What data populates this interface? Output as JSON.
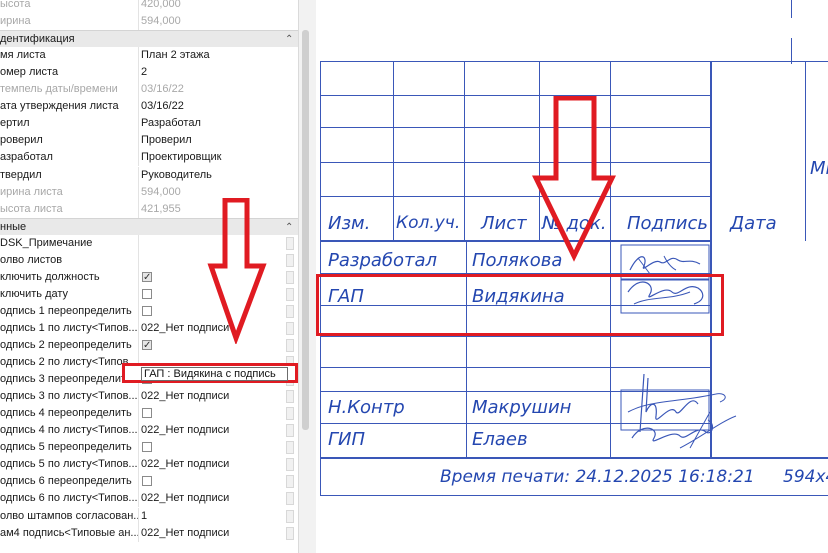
{
  "properties": {
    "rows": [
      {
        "name": "ысота",
        "value": "420,000",
        "dim": true
      },
      {
        "name": "ирина",
        "value": "594,000",
        "dim": true
      },
      {
        "name": "дентификация",
        "section": true
      },
      {
        "name": "мя листа",
        "value": "План 2  этажа"
      },
      {
        "name": "омер листа",
        "value": "2"
      },
      {
        "name": "темпель даты/времени",
        "value": "03/16/22",
        "dim": true
      },
      {
        "name": "ата утверждения листа",
        "value": "03/16/22"
      },
      {
        "name": "ертил",
        "value": "Разработал"
      },
      {
        "name": "роверил",
        "value": "Проверил"
      },
      {
        "name": "азработал",
        "value": "Проектировщик"
      },
      {
        "name": "твердил",
        "value": "Руководитель"
      },
      {
        "name": "ирина листа",
        "value": "594,000",
        "dim": true
      },
      {
        "name": "ысота листа",
        "value": "421,955",
        "dim": true
      },
      {
        "name": "нные",
        "section": true
      },
      {
        "name": "DSK_Примечание",
        "value": ""
      },
      {
        "name": "олво листов",
        "value": ""
      },
      {
        "name": "ключить должность",
        "checkbox": true,
        "checked": true
      },
      {
        "name": "ключить дату",
        "checkbox": true,
        "checked": false
      },
      {
        "name": "одпись 1 переопределить",
        "checkbox": true,
        "checked": false
      },
      {
        "name": "одпись 1 по листу<Типов...",
        "value": "022_Нет подписи"
      },
      {
        "name": "одпись 2 переопределить",
        "checkbox": true,
        "checked": true
      },
      {
        "name": "одпись 2 по листу<Типов...",
        "value": "ГАП : Видякина с подпись",
        "editing": true
      },
      {
        "name": "одпись 3 переопределить",
        "checkbox": true,
        "checked": false
      },
      {
        "name": "одпись 3 по листу<Типов...",
        "value": "022_Нет подписи"
      },
      {
        "name": "одпись 4 переопределить",
        "checkbox": true,
        "checked": false
      },
      {
        "name": "одпись 4 по листу<Типов...",
        "value": "022_Нет подписи"
      },
      {
        "name": "одпись 5 переопределить",
        "checkbox": true,
        "checked": false
      },
      {
        "name": "одпись 5 по листу<Типов...",
        "value": "022_Нет подписи"
      },
      {
        "name": "одпись 6 переопределить",
        "checkbox": true,
        "checked": false
      },
      {
        "name": "одпись 6 по листу<Типов...",
        "value": "022_Нет подписи"
      },
      {
        "name": "олво штампов согласован...",
        "value": "1"
      },
      {
        "name": "ам4 подпись<Типовые ан...",
        "value": "022_Нет подписи"
      }
    ]
  },
  "title_block": {
    "headers": [
      "Изм.",
      "Кол.уч.",
      "Лист",
      "№ док.",
      "Подпись",
      "Дата"
    ],
    "side_text": "Мк",
    "rows": [
      {
        "role": "Разработал",
        "name": "Полякова"
      },
      {
        "role": "ГАП",
        "name": "Видякина"
      },
      {
        "role": "Н.Контр",
        "name": "Макрушин"
      },
      {
        "role": "ГИП",
        "name": "Елаев"
      }
    ],
    "print_time": "Время печати: 24.12.2025  16:18:21",
    "format": "594x4"
  },
  "colors": {
    "annotation": "#e01b22",
    "drawing": "#3a57b8"
  }
}
